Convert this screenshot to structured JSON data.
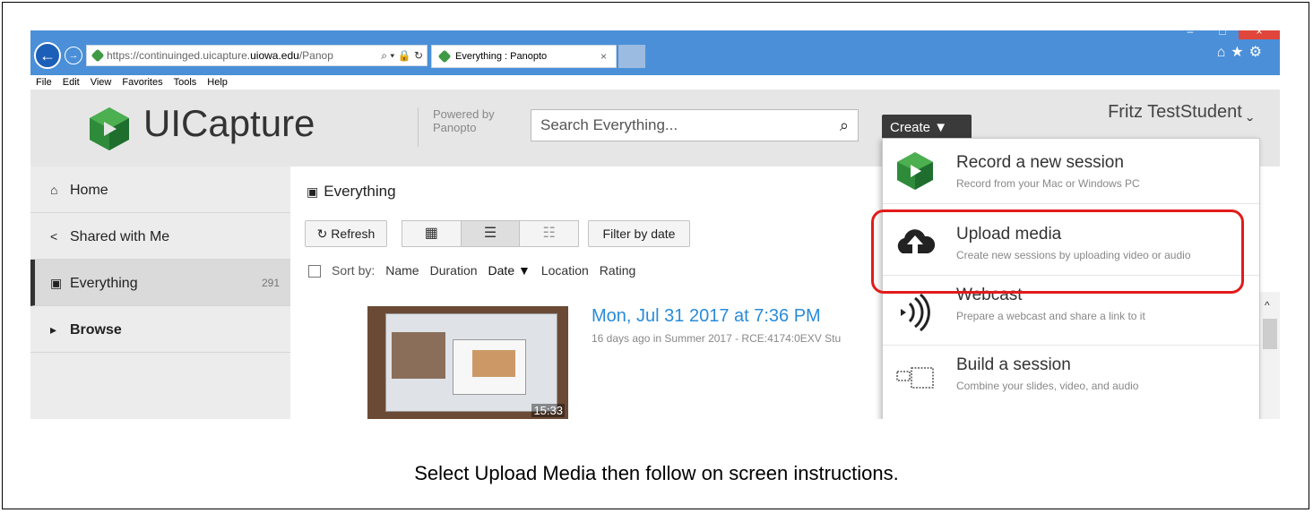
{
  "browser": {
    "address_prefix": "https://continuinged.uicapture.",
    "address_domain": "uiowa.edu",
    "address_suffix": "/Panop",
    "address_icons": "⌕ ▾ 🔒 ↻",
    "tab_title": "Everything : Panopto",
    "tab_close": "×",
    "back_glyph": "←",
    "fwd_glyph": "→",
    "toolbar_icons": "⌂★⚙",
    "min_glyph": "–",
    "max_glyph": "□",
    "close_glyph": "×",
    "menu": [
      "File",
      "Edit",
      "View",
      "Favorites",
      "Tools",
      "Help"
    ]
  },
  "header": {
    "brand": "UICapture",
    "powered_by_1": "Powered by",
    "powered_by_2": "Panopto",
    "search_placeholder": "Search Everything...",
    "search_icon": "⌕",
    "create_label": "Create ▼",
    "user_name": "Fritz TestStudent ˬ"
  },
  "sidebar": {
    "items": [
      {
        "icon": "⌂",
        "label": "Home"
      },
      {
        "icon": "<",
        "label": "Shared with Me"
      },
      {
        "icon": "▣",
        "label": "Everything",
        "count": "291"
      },
      {
        "icon": "▸",
        "label": "Browse"
      }
    ]
  },
  "main": {
    "crumb_icon": "▣",
    "crumb": "Everything",
    "refresh_label": "↻ Refresh",
    "view_icons": [
      "▦",
      "☰",
      "☷"
    ],
    "filter_label": "Filter by date",
    "sort_by": "Sort by:",
    "sort_fields": [
      "Name",
      "Duration",
      "Date ▼",
      "Location",
      "Rating"
    ],
    "session": {
      "title": "Mon, Jul 31 2017 at 7:36 PM",
      "meta": "16 days ago in Summer 2017 - RCE:4174:0EXV Stu",
      "duration": "15:33"
    },
    "scroll_up": "^"
  },
  "dropdown": {
    "items": [
      {
        "title": "Record a new session",
        "sub": "Record from your Mac or Windows PC",
        "icon": "record-icon"
      },
      {
        "title": "Upload media",
        "sub": "Create new sessions by uploading video or audio",
        "icon": "cloud-upload-icon"
      },
      {
        "title": "Webcast",
        "sub": "Prepare a webcast and share a link to it",
        "icon": "broadcast-icon"
      },
      {
        "title": "Build a session",
        "sub": "Combine your slides, video, and audio",
        "icon": "build-session-icon"
      }
    ]
  },
  "caption": "Select Upload Media then follow on screen instructions.",
  "colors": {
    "accent": "#2a8bd8",
    "highlight": "#e21b1b",
    "titlebar": "#4a8fd8"
  }
}
